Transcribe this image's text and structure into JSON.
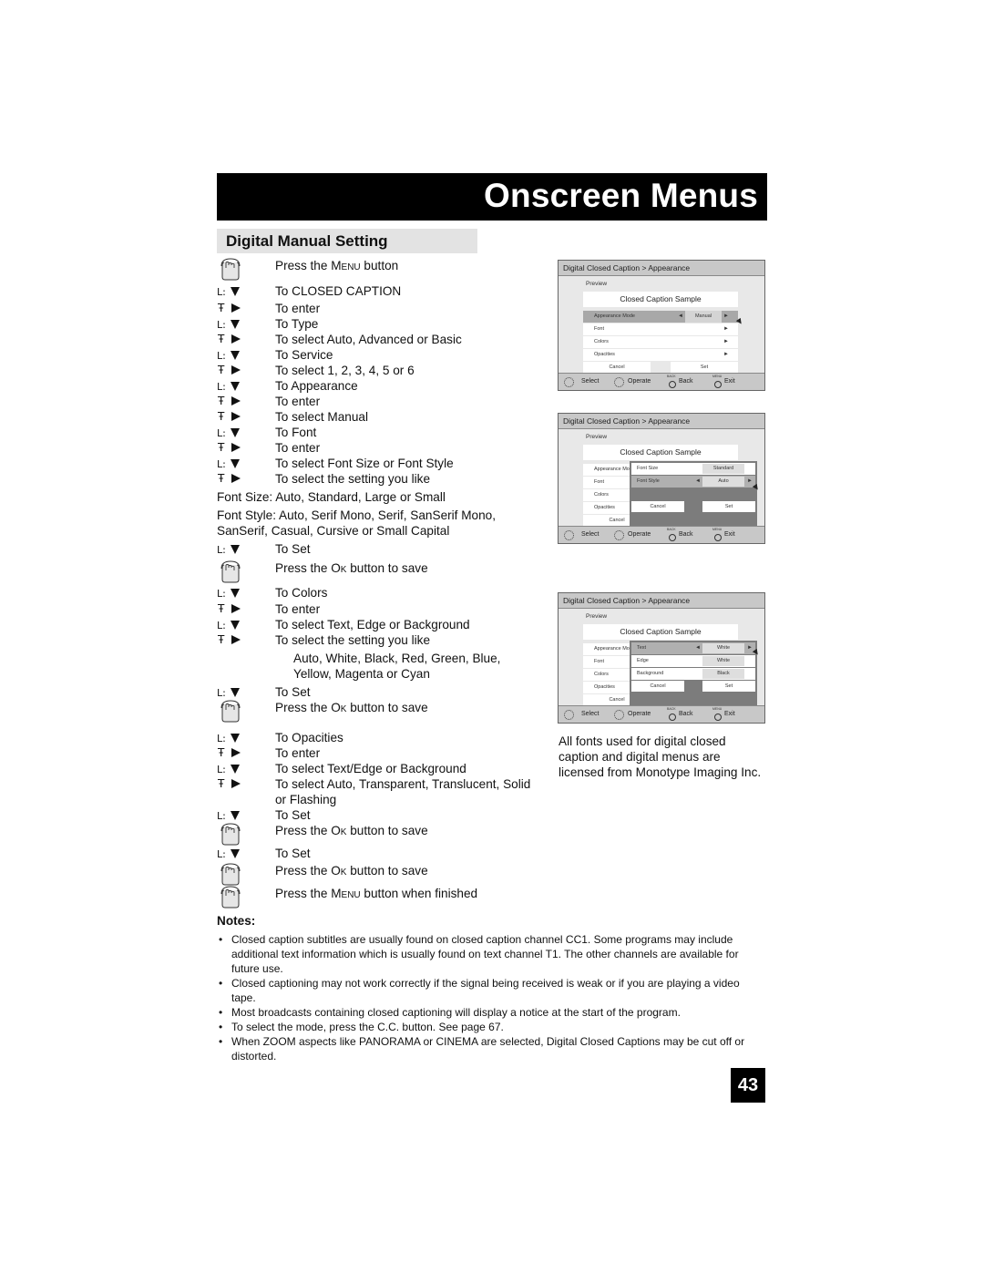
{
  "banner": {
    "title": "Onscreen Menus"
  },
  "section": {
    "title": "Digital Manual Setting"
  },
  "steps": [
    {
      "icon": "hand",
      "pre": "Press the ",
      "sc": "Menu",
      "post": " button"
    },
    {
      "icon": "down",
      "text": "To CLOSED CAPTION"
    },
    {
      "icon": "right",
      "text": "To enter"
    },
    {
      "icon": "down",
      "text": "To Type"
    },
    {
      "icon": "right",
      "text": "To select Auto, Advanced or Basic"
    },
    {
      "icon": "down",
      "text": "To Service"
    },
    {
      "icon": "right",
      "text": "To select 1, 2, 3, 4, 5 or 6"
    },
    {
      "icon": "down",
      "text": "To Appearance"
    },
    {
      "icon": "right",
      "text": "To enter"
    },
    {
      "icon": "right",
      "text": "To select Manual"
    },
    {
      "icon": "down",
      "text": "To Font"
    },
    {
      "icon": "right",
      "text": "To enter"
    },
    {
      "icon": "down",
      "text": "To select Font Size or Font Style"
    },
    {
      "icon": "right",
      "text": "To select the setting you like"
    }
  ],
  "font_size_note": "Font Size: Auto, Standard, Large or Small",
  "font_style_note": [
    "Font Style: Auto, Serif Mono, Serif, SanSerif Mono,",
    "SanSerif, Casual, Cursive or Small Capital"
  ],
  "steps2": [
    {
      "icon": "down",
      "text": "To Set"
    },
    {
      "icon": "hand",
      "pre": "Press the ",
      "sc": "Ok",
      "post": " button to save"
    },
    {
      "icon": "down",
      "text": "To Colors"
    },
    {
      "icon": "right",
      "text": "To enter"
    },
    {
      "icon": "down",
      "text": "To select Text, Edge or Background"
    },
    {
      "icon": "right",
      "text": "To select the setting you like"
    }
  ],
  "color_options": [
    "Auto, White, Black, Red, Green, Blue,",
    "Yellow, Magenta or Cyan"
  ],
  "steps3": [
    {
      "icon": "down",
      "text": "To Set"
    },
    {
      "icon": "hand",
      "pre": "Press the ",
      "sc": "Ok",
      "post": " button to save"
    },
    {
      "icon": "down",
      "text": "To Opacities"
    },
    {
      "icon": "right",
      "text": "To enter"
    },
    {
      "icon": "down",
      "text": "To select Text/Edge or Background"
    },
    {
      "icon": "right",
      "text": "To select Auto, Transparent, Translucent, Solid"
    },
    {
      "icon": "none",
      "text": "or Flashing"
    },
    {
      "icon": "down",
      "text": "To Set"
    },
    {
      "icon": "hand",
      "pre": "Press the ",
      "sc": "Ok",
      "post": " button to save"
    },
    {
      "icon": "down",
      "text": "To Set"
    },
    {
      "icon": "hand",
      "pre": "Press the ",
      "sc": "Ok",
      "post": " button to save"
    },
    {
      "icon": "hand",
      "pre": "Press the ",
      "sc": "Menu",
      "post": " button when finished"
    }
  ],
  "screens": [
    {
      "header": "Digital Closed Caption  >  Appearance",
      "preview_label": "Preview",
      "sample": "Closed Caption Sample",
      "rows": [
        {
          "label": "Appearance Mode",
          "value": "Manual",
          "highlight": true
        },
        {
          "label": "Font"
        },
        {
          "label": "Colors"
        },
        {
          "label": "Opacities"
        }
      ],
      "cancel": "Cancel",
      "set": "Set"
    },
    {
      "header": "Digital Closed Caption  >  Appearance",
      "preview_label": "Preview",
      "sample": "Closed Caption Sample",
      "rows": [
        {
          "label": "Appearance Mode"
        },
        {
          "label": "Font"
        },
        {
          "label": "Colors"
        },
        {
          "label": "Opacities"
        }
      ],
      "popup": [
        {
          "label": "Font Size",
          "value": "Standard"
        },
        {
          "label": "Font Style",
          "value": "Auto",
          "highlight": true
        }
      ],
      "cancel": "Cancel",
      "set": "Set"
    },
    {
      "header": "Digital Closed Caption  >  Appearance",
      "preview_label": "Preview",
      "sample": "Closed Caption Sample",
      "rows": [
        {
          "label": "Appearance Mode"
        },
        {
          "label": "Font"
        },
        {
          "label": "Colors"
        },
        {
          "label": "Opacities"
        }
      ],
      "popup": [
        {
          "label": "Text",
          "value": "White",
          "highlight": true
        },
        {
          "label": "Edge",
          "value": "White"
        },
        {
          "label": "Background",
          "value": "Black"
        }
      ],
      "cancel": "Cancel",
      "set": "Set"
    }
  ],
  "screen_footer": {
    "select": "Select",
    "operate": "Operate",
    "back_small": "BACK",
    "back": "Back",
    "menu_small": "MENU",
    "exit": "Exit"
  },
  "side_note": "All fonts used for digital closed caption and digital menus are licensed from Monotype Imaging Inc.",
  "notes_title": "Notes:",
  "notes": [
    "Closed caption subtitles are usually found on closed caption channel CC1. Some programs may include additional text information which is usually found on text channel T1. The other channels are available for future use.",
    "Closed captioning may not work correctly if the signal being received is weak or if you are playing a video tape.",
    "Most broadcasts containing closed captioning will display a notice at the start of the program.",
    "To select the mode, press the C.C. button. See page 67.",
    "When ZOOM aspects like PANORAMA or CINEMA are selected, Digital Closed Captions may be cut off or distorted."
  ],
  "page_number": "43"
}
